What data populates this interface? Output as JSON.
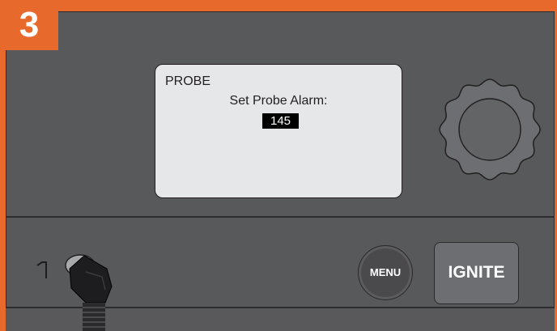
{
  "step_badge": "3",
  "display": {
    "mode_label": "PROBE",
    "prompt": "Set Probe Alarm:",
    "value": "145"
  },
  "buttons": {
    "menu": "MENU",
    "ignite": "IGNITE"
  },
  "icons": {
    "knob": "control-knob-icon",
    "probe_port": "probe-port-icon",
    "probe_plug": "probe-plug-icon"
  },
  "colors": {
    "accent": "#e8692c",
    "panel": "#58595b",
    "display_bg": "#e6e7e8",
    "value_highlight": "#000000"
  }
}
